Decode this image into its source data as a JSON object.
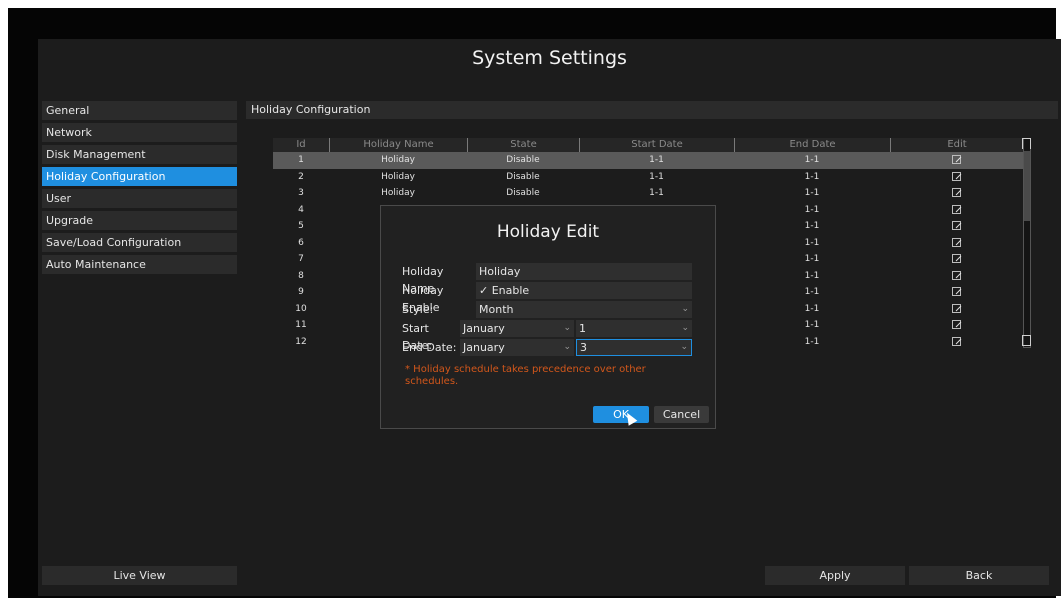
{
  "window": {
    "title": "System Settings"
  },
  "sidebar": {
    "items": [
      {
        "label": "General",
        "active": false
      },
      {
        "label": "Network",
        "active": false
      },
      {
        "label": "Disk Management",
        "active": false
      },
      {
        "label": "Holiday Configuration",
        "active": true
      },
      {
        "label": "User",
        "active": false
      },
      {
        "label": "Upgrade",
        "active": false
      },
      {
        "label": "Save/Load Configuration",
        "active": false
      },
      {
        "label": "Auto Maintenance",
        "active": false
      }
    ],
    "live_view_label": "Live View"
  },
  "section": {
    "title": "Holiday Configuration"
  },
  "table": {
    "columns": [
      "Id",
      "Holiday Name",
      "State",
      "Start Date",
      "End Date",
      "Edit"
    ],
    "rows": [
      {
        "id": "1",
        "name": "Holiday",
        "state": "Disable",
        "start": "1-1",
        "end": "1-1"
      },
      {
        "id": "2",
        "name": "Holiday",
        "state": "Disable",
        "start": "1-1",
        "end": "1-1"
      },
      {
        "id": "3",
        "name": "Holiday",
        "state": "Disable",
        "start": "1-1",
        "end": "1-1"
      },
      {
        "id": "4",
        "name": "",
        "state": "",
        "start": "",
        "end": "1-1"
      },
      {
        "id": "5",
        "name": "",
        "state": "",
        "start": "",
        "end": "1-1"
      },
      {
        "id": "6",
        "name": "",
        "state": "",
        "start": "",
        "end": "1-1"
      },
      {
        "id": "7",
        "name": "",
        "state": "",
        "start": "",
        "end": "1-1"
      },
      {
        "id": "8",
        "name": "",
        "state": "",
        "start": "",
        "end": "1-1"
      },
      {
        "id": "9",
        "name": "",
        "state": "",
        "start": "",
        "end": "1-1"
      },
      {
        "id": "10",
        "name": "",
        "state": "",
        "start": "",
        "end": "1-1"
      },
      {
        "id": "11",
        "name": "",
        "state": "",
        "start": "",
        "end": "1-1"
      },
      {
        "id": "12",
        "name": "",
        "state": "",
        "start": "",
        "end": "1-1"
      }
    ],
    "selected_row": 0,
    "edit_icon": "edit-icon"
  },
  "dialog": {
    "title": "Holiday Edit",
    "holiday_name_label": "Holiday Name",
    "holiday_name_value": "Holiday",
    "holiday_enable_label": "Holiday Enable",
    "enable_check": "✓",
    "enable_label": "Enable",
    "style_label": "Style:",
    "style_value": "Month",
    "start_date_label": "Start Date:",
    "start_month": "January",
    "start_day": "1",
    "end_date_label": "End Date:",
    "end_month": "January",
    "end_day": "3",
    "warning": "* Holiday schedule takes precedence over other schedules.",
    "ok_label": "OK",
    "cancel_label": "Cancel"
  },
  "footer": {
    "apply_label": "Apply",
    "back_label": "Back"
  },
  "colors": {
    "accent": "#1f8fe0",
    "warning": "#d2571b",
    "background": "#1c1c1c"
  }
}
